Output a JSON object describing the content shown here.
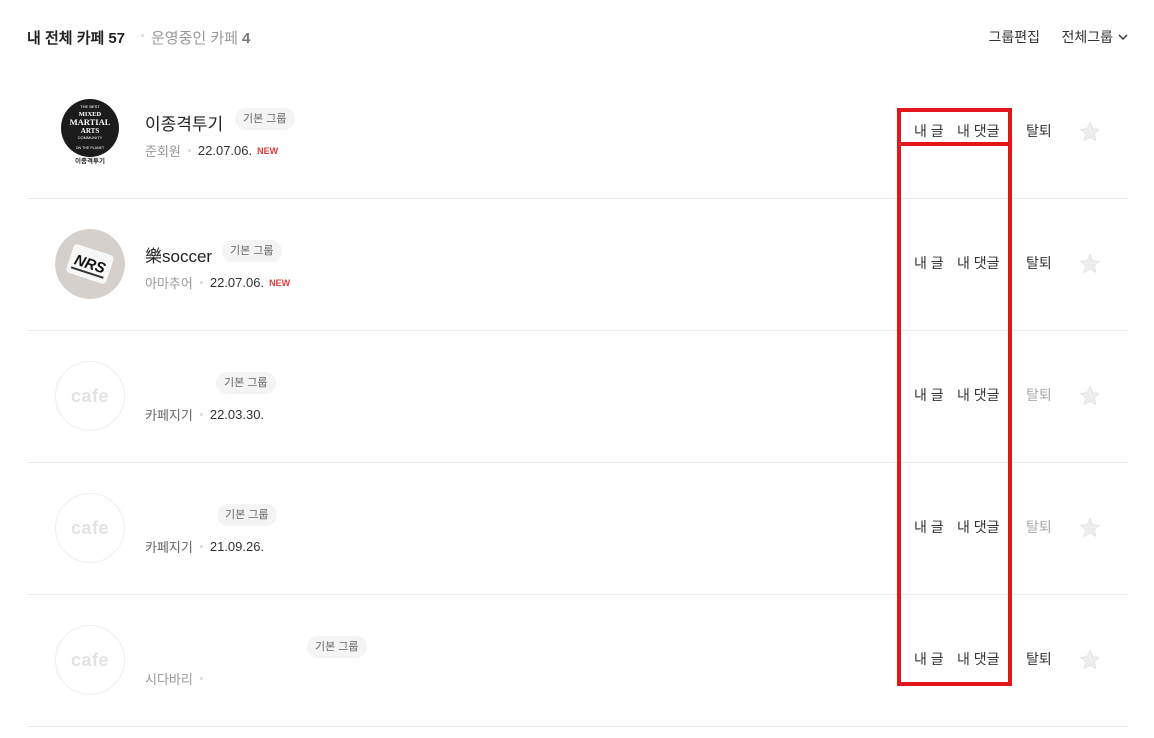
{
  "header": {
    "my_cafes_label": "내 전체 카페",
    "my_cafes_count": "57",
    "running_cafes_label": "운영중인 카페",
    "running_cafes_count": "4",
    "group_edit_label": "그룹편집",
    "group_select_label": "전체그룹"
  },
  "cafes": [
    {
      "name": "이종격투기",
      "group_badge": "기본 그룹",
      "grade": "준회원",
      "date": "22.07.06.",
      "new_label": "NEW",
      "thumb_text": [
        "THE BEST",
        "MIXED",
        "MARTIAL",
        "ARTS",
        "COMMUNITY",
        "ON THE PLANET",
        "이종격투기"
      ],
      "actions": {
        "posts": "내 글",
        "comments": "내 댓글",
        "leave": "탈퇴"
      }
    },
    {
      "name": "樂soccer",
      "group_badge": "기본 그룹",
      "grade": "아마추어",
      "date": "22.07.06.",
      "new_label": "NEW",
      "thumb_text": [
        "NRS"
      ],
      "actions": {
        "posts": "내 글",
        "comments": "내 댓글",
        "leave": "탈퇴"
      }
    },
    {
      "name": "",
      "group_badge": "기본 그룹",
      "grade": "카페지기",
      "date": "22.03.30.",
      "new_label": "",
      "thumb_text": [
        "cafe"
      ],
      "actions": {
        "posts": "내 글",
        "comments": "내 댓글",
        "leave": "탈퇴"
      }
    },
    {
      "name": "",
      "group_badge": "기본 그룹",
      "grade": "카페지기",
      "date": "21.09.26.",
      "new_label": "",
      "thumb_text": [
        "cafe"
      ],
      "actions": {
        "posts": "내 글",
        "comments": "내 댓글",
        "leave": "탈퇴"
      }
    },
    {
      "name": "",
      "group_badge": "기본 그룹",
      "grade": "시다바리",
      "date": "",
      "new_label": "",
      "thumb_text": [
        "cafe"
      ],
      "actions": {
        "posts": "내 글",
        "comments": "내 댓글",
        "leave": "탈퇴"
      }
    }
  ],
  "colors": {
    "highlight": "#e3161e",
    "new_badge": "#e03c3c",
    "badge_bg": "#f4f4f4"
  }
}
